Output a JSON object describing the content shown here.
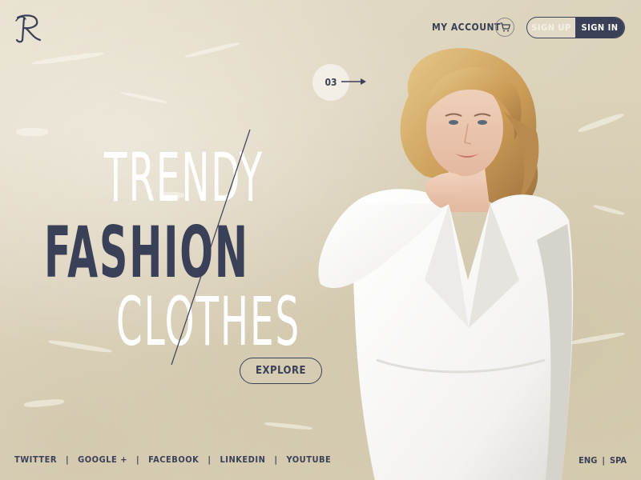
{
  "brand": {
    "logo_letter": "R"
  },
  "header": {
    "account_label": "MY ACCOUNT",
    "cart_icon": "cart-icon",
    "signup_label": "SIGN UP",
    "signin_label": "SIGN IN"
  },
  "slider": {
    "current": "03",
    "next_icon": "arrow-right-icon"
  },
  "hero": {
    "line1": "TRENDY",
    "line2": "FASHION",
    "line3": "CLOTHES",
    "cta_label": "EXPLORE"
  },
  "footer": {
    "social": [
      "TWITTER",
      "GOOGLE +",
      "FACEBOOK",
      "LINKEDIN",
      "YOUTUBE"
    ],
    "languages": [
      "ENG",
      "SPA"
    ]
  },
  "colors": {
    "navy": "#3a4057",
    "background": "#e2dac6",
    "white": "#ffffff"
  }
}
